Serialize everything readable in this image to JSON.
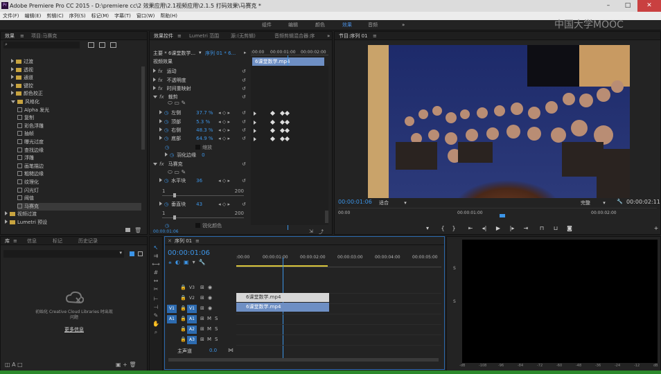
{
  "titlebar": {
    "app_title": "Adobe Premiere Pro CC 2015 - D:\\premiere cc\\2 效果应用\\2.1视频应用\\2.1.5 打码效果\\马赛克 *",
    "logo": "Pr"
  },
  "menu": [
    "文件(F)",
    "编辑(E)",
    "剪辑(C)",
    "序列(S)",
    "标记(M)",
    "字幕(T)",
    "窗口(W)",
    "帮助(H)"
  ],
  "workspaces": [
    "组件",
    "编辑",
    "颜色",
    "效果",
    "音频"
  ],
  "workspace_active": "效果",
  "watermark": "中国大学MOOC",
  "effects_panel": {
    "tabs": [
      "效果",
      "项目:马赛克"
    ],
    "items": [
      {
        "label": "过渡",
        "indent": 1,
        "kind": "folder"
      },
      {
        "label": "透视",
        "indent": 1,
        "kind": "folder"
      },
      {
        "label": "通道",
        "indent": 1,
        "kind": "folder"
      },
      {
        "label": "键控",
        "indent": 1,
        "kind": "folder"
      },
      {
        "label": "颜色校正",
        "indent": 1,
        "kind": "folder"
      },
      {
        "label": "风格化",
        "indent": 1,
        "kind": "folder-open"
      },
      {
        "label": "Alpha 发光",
        "indent": 2,
        "kind": "fx"
      },
      {
        "label": "复制",
        "indent": 2,
        "kind": "fx"
      },
      {
        "label": "彩色浮雕",
        "indent": 2,
        "kind": "fx"
      },
      {
        "label": "抽帧",
        "indent": 2,
        "kind": "fx"
      },
      {
        "label": "曝光过度",
        "indent": 2,
        "kind": "fx"
      },
      {
        "label": "查找边缘",
        "indent": 2,
        "kind": "fx"
      },
      {
        "label": "浮雕",
        "indent": 2,
        "kind": "fx"
      },
      {
        "label": "画笔描边",
        "indent": 2,
        "kind": "fx"
      },
      {
        "label": "粗糙边缘",
        "indent": 2,
        "kind": "fx"
      },
      {
        "label": "纹理化",
        "indent": 2,
        "kind": "fx"
      },
      {
        "label": "闪光灯",
        "indent": 2,
        "kind": "fx"
      },
      {
        "label": "阈值",
        "indent": 2,
        "kind": "fx"
      },
      {
        "label": "马赛克",
        "indent": 2,
        "kind": "fx"
      },
      {
        "label": "视频过渡",
        "indent": 0,
        "kind": "folder"
      },
      {
        "label": "Lumetri 预设",
        "indent": 0,
        "kind": "folder"
      }
    ]
  },
  "effect_controls": {
    "tabs": [
      "效果控件",
      "Lumetri 范围",
      "源:(无剪辑)",
      "音频剪辑混合器:序"
    ],
    "master": "主要 * 6课堂数学...",
    "sequence": "序列 01 * 6...",
    "clip_label": "6课堂数学.mp4",
    "section": "视频效果",
    "timecodes": [
      ":00:00",
      "00:00:01:00",
      "00:00:02:00"
    ],
    "rows": [
      {
        "label": "运动",
        "kind": "fx"
      },
      {
        "label": "不透明度",
        "kind": "fx"
      },
      {
        "label": "时间重映射",
        "kind": "fx"
      },
      {
        "label": "裁剪",
        "kind": "fx-open"
      },
      {
        "label": "左侧",
        "value": "37.7 %",
        "kind": "param"
      },
      {
        "label": "顶部",
        "value": "5.3 %",
        "kind": "param"
      },
      {
        "label": "右侧",
        "value": "48.3 %",
        "kind": "param"
      },
      {
        "label": "底部",
        "value": "64.9 %",
        "kind": "param"
      },
      {
        "label": "",
        "value": "缩放",
        "kind": "check"
      },
      {
        "label": "羽化边缘",
        "value": "0",
        "kind": "plain"
      },
      {
        "label": "马赛克",
        "kind": "fx-open"
      },
      {
        "label": "水平块",
        "value": "36",
        "kind": "param"
      },
      {
        "label": "1",
        "value": "200",
        "kind": "range"
      },
      {
        "label": "垂直块",
        "value": "43",
        "kind": "param"
      },
      {
        "label": "1",
        "value": "200",
        "kind": "range"
      },
      {
        "label": "",
        "value": "锐化颜色",
        "kind": "check"
      }
    ],
    "current_time": "00:00:01:06"
  },
  "program_monitor": {
    "title": "节目:序列 01",
    "timecode": "00:00:01:06",
    "fit": "适合",
    "quality": "完整",
    "duration": "00:00:02:11",
    "ruler": [
      "00:00",
      "00:00:01:00",
      "00:00:02:00"
    ]
  },
  "project_panel": {
    "tabs": [
      "库",
      "信息",
      "标记",
      "历史记录"
    ],
    "cloud_text": "初始化 Creative Cloud Libraries 时出现问题",
    "more_info": "更多信息"
  },
  "timeline": {
    "tab": "序列 01",
    "timecode": "00:00:01:06",
    "ruler": [
      ":00:00",
      "00:00:01:00",
      "00:00:02:00",
      "00:00:03:00",
      "00:00:04:00",
      "00:00:05:00"
    ],
    "tracks": [
      {
        "name": "V3",
        "src": ""
      },
      {
        "name": "V2",
        "src": ""
      },
      {
        "name": "V1",
        "src": "V1"
      },
      {
        "name": "A1",
        "src": "A1"
      },
      {
        "name": "A2",
        "src": ""
      },
      {
        "name": "A3",
        "src": ""
      }
    ],
    "master_track": "主声道",
    "master_value": "0.0",
    "clips": [
      {
        "label": "6课堂数学.mp4",
        "track": "V2"
      },
      {
        "label": "6课堂数学.mp4",
        "track": "V1"
      }
    ]
  },
  "audio_meter": {
    "scale": [
      "-dB",
      "-108",
      "-96",
      "-84",
      "-72",
      "-60",
      "-48",
      "-36",
      "-24",
      "-12",
      "dB"
    ],
    "side": [
      "S",
      "S"
    ]
  }
}
